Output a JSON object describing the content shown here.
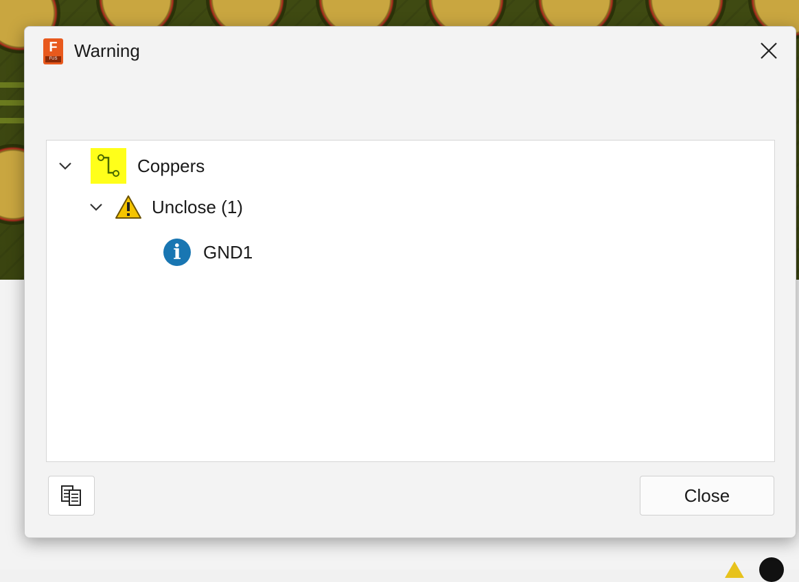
{
  "window": {
    "title": "Warning",
    "app_icon": {
      "letter": "F",
      "badge": "FUS"
    }
  },
  "tree": {
    "root": {
      "label": "Coppers",
      "icon": "copper-trace-icon",
      "expanded": true,
      "children": [
        {
          "label": "Unclose (1)",
          "icon": "warning-icon",
          "expanded": true,
          "selected": true,
          "children": [
            {
              "label": "GND1",
              "icon": "info-icon"
            }
          ]
        }
      ]
    }
  },
  "footer": {
    "copy_icon": "copy-report-icon",
    "close_label": "Close"
  },
  "colors": {
    "selection": "#dcdcdc",
    "copper_icon_bg": "#ffff1a",
    "info_icon": "#1976b2",
    "warning_icon": "#f5c400"
  }
}
